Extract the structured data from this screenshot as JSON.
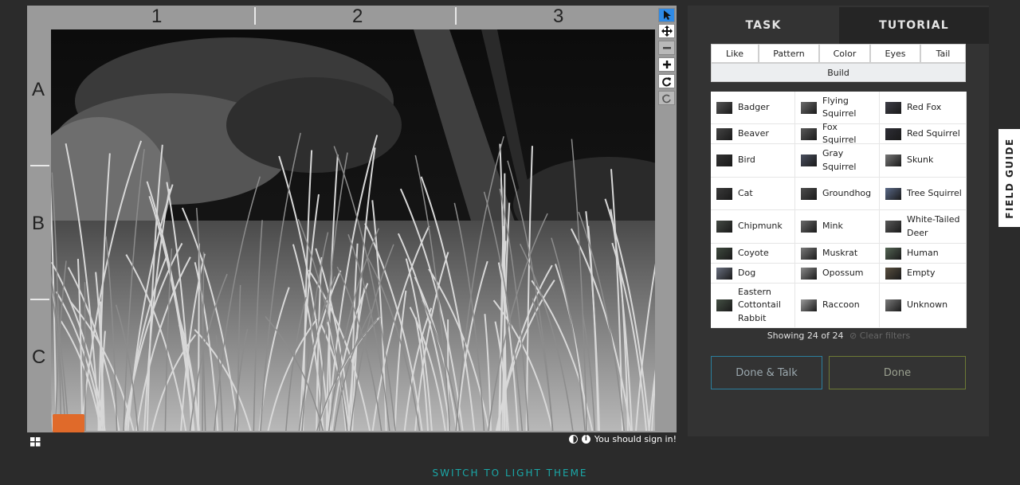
{
  "viewer": {
    "columns": [
      "1",
      "2",
      "3"
    ],
    "rows": [
      "A",
      "B",
      "C"
    ],
    "toolbar": [
      {
        "name": "pointer-icon",
        "state": "active"
      },
      {
        "name": "move-icon",
        "state": "normal"
      },
      {
        "name": "zoom-out-icon",
        "state": "disabled"
      },
      {
        "name": "zoom-in-icon",
        "state": "normal"
      },
      {
        "name": "rotate-icon",
        "state": "normal"
      },
      {
        "name": "reset-icon",
        "state": "disabled"
      }
    ],
    "signin_text": "You should sign in!",
    "info_glyph": "i"
  },
  "tabs": {
    "task": "TASK",
    "tutorial": "TUTORIAL"
  },
  "filters": {
    "items": [
      "Like",
      "Pattern",
      "Color",
      "Eyes",
      "Tail"
    ],
    "build": "Build"
  },
  "choices": [
    "Badger",
    "Flying Squirrel",
    "Red Fox",
    "Beaver",
    "Fox Squirrel",
    "Red Squirrel",
    "Bird",
    "Gray Squirrel",
    "Skunk",
    "Cat",
    "Groundhog",
    "Tree Squirrel",
    "Chipmunk",
    "Mink",
    "White-Tailed Deer",
    "Coyote",
    "Muskrat",
    "Human",
    "Dog",
    "Opossum",
    "Empty",
    "Eastern Cottontail Rabbit",
    "Raccoon",
    "Unknown"
  ],
  "showing": {
    "text": "Showing 24 of 24",
    "clear": "Clear filters"
  },
  "buttons": {
    "done_talk": "Done & Talk",
    "done": "Done"
  },
  "field_guide": "FIELD GUIDE",
  "theme_toggle": "SWITCH TO LIGHT THEME",
  "colors": {
    "background": "#2b2b2b",
    "panel": "#333333",
    "toolbar_active": "#2e8ae6",
    "done_talk_border": "#2b7f9e",
    "done_border": "#6d7a36",
    "theme_link": "#1aa8a8"
  }
}
